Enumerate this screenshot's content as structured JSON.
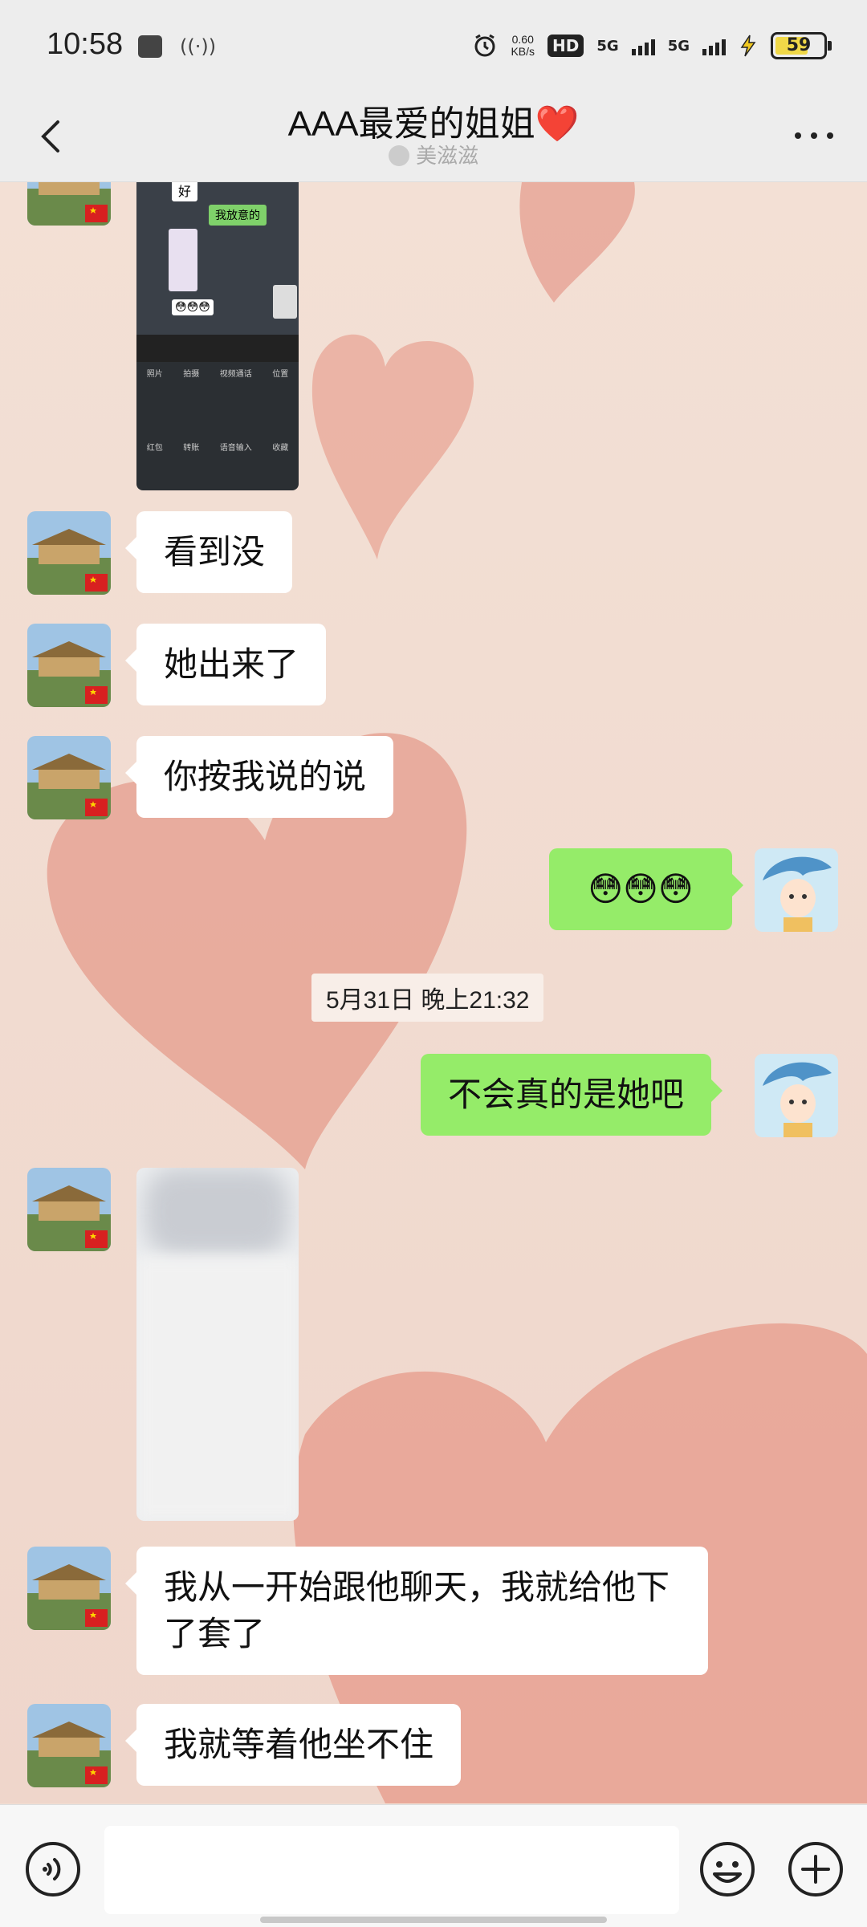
{
  "status_bar": {
    "time": "10:58",
    "network_speed": "0.60",
    "network_unit": "KB/s",
    "hd_label": "HD",
    "sim_label": "5G",
    "sim2_label": "5G",
    "battery": "59"
  },
  "header": {
    "title": "AAA最爱的姐姐❤️",
    "subtitle": "美滋滋"
  },
  "screenshot_preview": {
    "msg1": "好",
    "msg2": "我放意的",
    "emoji": "😳😳😳",
    "panel_row1": [
      "照片",
      "拍摄",
      "视频通话",
      "位置"
    ],
    "panel_row2": [
      "红包",
      "转账",
      "语音输入",
      "收藏"
    ]
  },
  "messages": [
    {
      "side": "left",
      "text": "看到没"
    },
    {
      "side": "left",
      "text": "她出来了"
    },
    {
      "side": "left",
      "text": "你按我说的说"
    },
    {
      "side": "right",
      "text": "😳😳😳"
    },
    {
      "side": "right",
      "text": "不会真的是她吧"
    },
    {
      "side": "left",
      "text": "我从一开始跟他聊天，我就给他下了套了"
    },
    {
      "side": "left",
      "text": "我就等着他坐不住"
    }
  ],
  "timestamp": "5月31日 晚上21:32",
  "colors": {
    "bubble_self": "#95ec69",
    "bubble_other": "#ffffff",
    "background": "#f2ded2",
    "heart": "#e4a294"
  },
  "bottom_bar": {
    "voice_icon": "voice-icon",
    "emoji_icon": "emoji-icon",
    "plus_icon": "plus-icon",
    "input_placeholder": ""
  }
}
